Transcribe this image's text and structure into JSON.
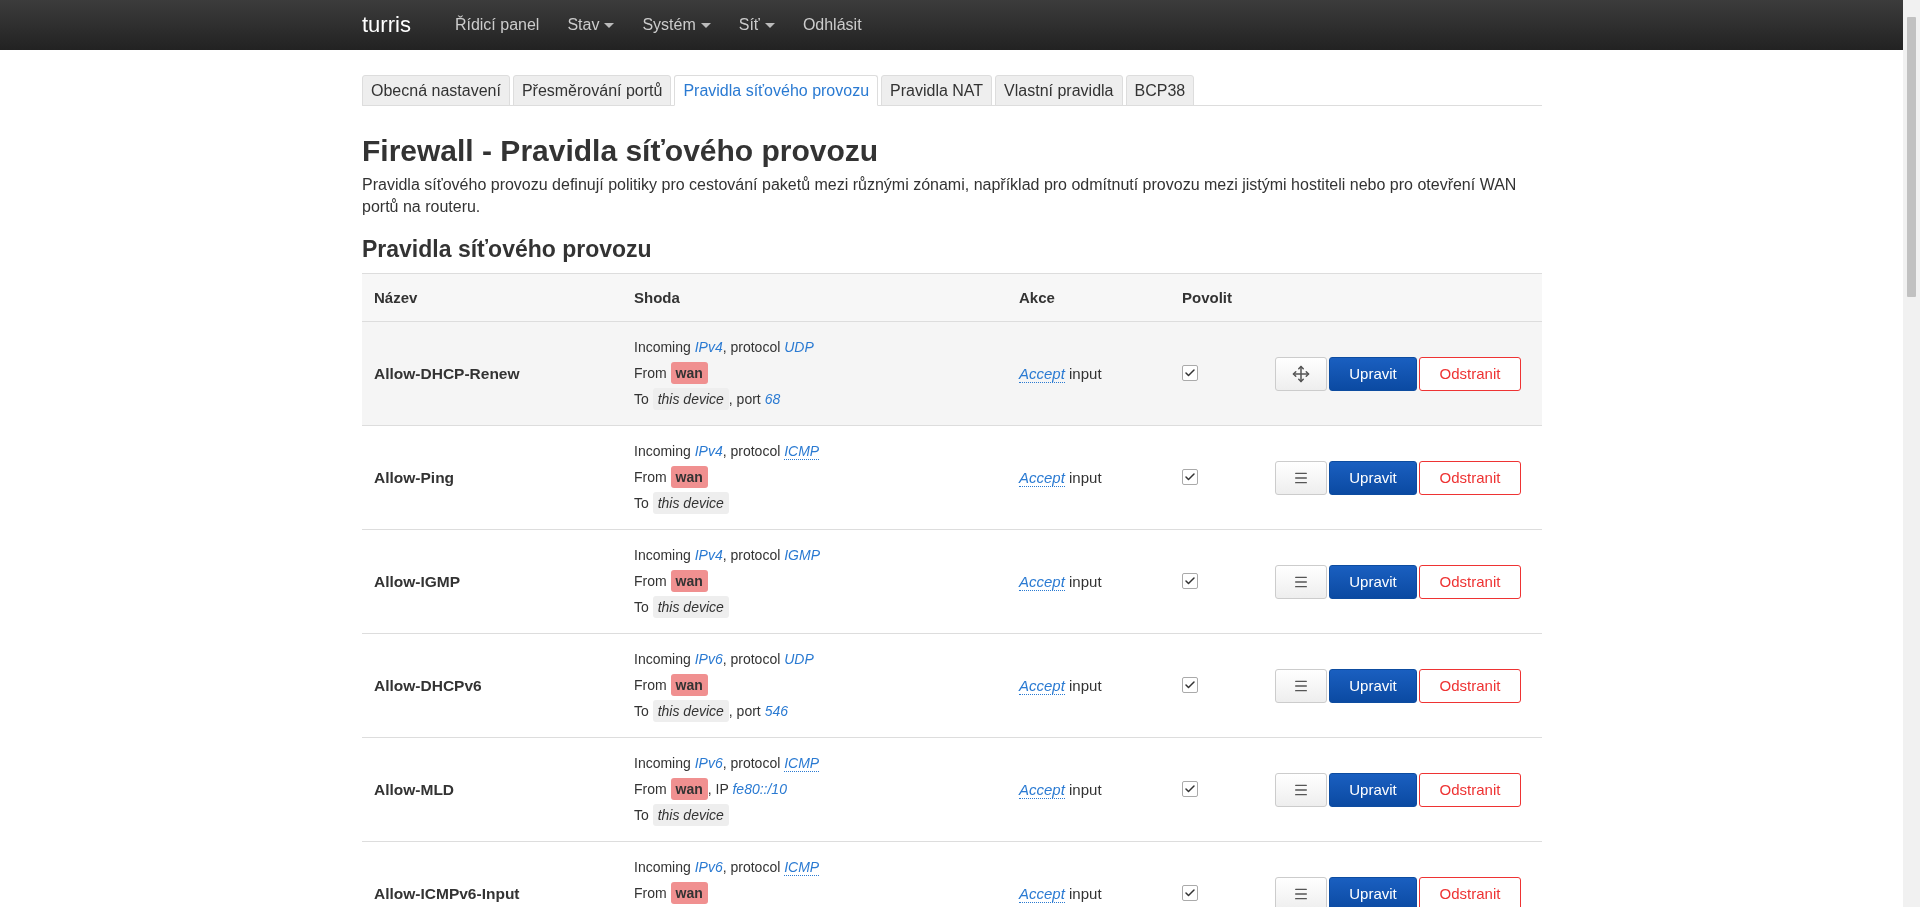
{
  "navbar": {
    "brand": "turris",
    "items": [
      {
        "label": "Řídicí panel",
        "dropdown": false
      },
      {
        "label": "Stav",
        "dropdown": true
      },
      {
        "label": "Systém",
        "dropdown": true
      },
      {
        "label": "Síť",
        "dropdown": true
      },
      {
        "label": "Odhlásit",
        "dropdown": false
      }
    ]
  },
  "tabs": [
    {
      "label": "Obecná nastavení",
      "selected": false
    },
    {
      "label": "Přesměrování portů",
      "selected": false
    },
    {
      "label": "Pravidla síťového provozu",
      "selected": true
    },
    {
      "label": "Pravidla NAT",
      "selected": false
    },
    {
      "label": "Vlastní pravidla",
      "selected": false
    },
    {
      "label": "BCP38",
      "selected": false
    }
  ],
  "title": "Firewall - Pravidla síťového provozu",
  "description": "Pravidla síťového provozu definují politiky pro cestování paketů mezi různými zónami, například pro odmítnutí provozu mezi jistými hostiteli nebo pro otevření WAN portů na routeru.",
  "section_title": "Pravidla síťového provozu",
  "table": {
    "columns": [
      "Název",
      "Shoda",
      "Akce",
      "Povolit"
    ],
    "rows": [
      {
        "name": "Allow-DHCP-Renew",
        "hovered": true,
        "match": [
          [
            {
              "kind": "text",
              "text": "Incoming "
            },
            {
              "kind": "value",
              "text": "IPv4"
            },
            {
              "kind": "text",
              "text": ", protocol "
            },
            {
              "kind": "value",
              "text": "UDP"
            }
          ],
          [
            {
              "kind": "text",
              "text": "From "
            },
            {
              "kind": "zone",
              "text": "wan"
            }
          ],
          [
            {
              "kind": "text",
              "text": "To "
            },
            {
              "kind": "device",
              "text": "this device"
            },
            {
              "kind": "text",
              "text": ", port "
            },
            {
              "kind": "value",
              "text": "68"
            }
          ]
        ],
        "action": "Accept",
        "action_suffix": "input",
        "enabled": true,
        "edit": "Upravit",
        "delete": "Odstranit"
      },
      {
        "name": "Allow-Ping",
        "hovered": false,
        "match": [
          [
            {
              "kind": "text",
              "text": "Incoming "
            },
            {
              "kind": "value",
              "text": "IPv4"
            },
            {
              "kind": "text",
              "text": ", protocol "
            },
            {
              "kind": "abbr",
              "text": "ICMP"
            }
          ],
          [
            {
              "kind": "text",
              "text": "From "
            },
            {
              "kind": "zone",
              "text": "wan"
            }
          ],
          [
            {
              "kind": "text",
              "text": "To "
            },
            {
              "kind": "device",
              "text": "this device"
            }
          ]
        ],
        "action": "Accept",
        "action_suffix": "input",
        "enabled": true,
        "edit": "Upravit",
        "delete": "Odstranit"
      },
      {
        "name": "Allow-IGMP",
        "hovered": false,
        "match": [
          [
            {
              "kind": "text",
              "text": "Incoming "
            },
            {
              "kind": "value",
              "text": "IPv4"
            },
            {
              "kind": "text",
              "text": ", protocol "
            },
            {
              "kind": "value",
              "text": "IGMP"
            }
          ],
          [
            {
              "kind": "text",
              "text": "From "
            },
            {
              "kind": "zone",
              "text": "wan"
            }
          ],
          [
            {
              "kind": "text",
              "text": "To "
            },
            {
              "kind": "device",
              "text": "this device"
            }
          ]
        ],
        "action": "Accept",
        "action_suffix": "input",
        "enabled": true,
        "edit": "Upravit",
        "delete": "Odstranit"
      },
      {
        "name": "Allow-DHCPv6",
        "hovered": false,
        "match": [
          [
            {
              "kind": "text",
              "text": "Incoming "
            },
            {
              "kind": "value",
              "text": "IPv6"
            },
            {
              "kind": "text",
              "text": ", protocol "
            },
            {
              "kind": "value",
              "text": "UDP"
            }
          ],
          [
            {
              "kind": "text",
              "text": "From "
            },
            {
              "kind": "zone",
              "text": "wan"
            }
          ],
          [
            {
              "kind": "text",
              "text": "To "
            },
            {
              "kind": "device",
              "text": "this device"
            },
            {
              "kind": "text",
              "text": ", port "
            },
            {
              "kind": "value",
              "text": "546"
            }
          ]
        ],
        "action": "Accept",
        "action_suffix": "input",
        "enabled": true,
        "edit": "Upravit",
        "delete": "Odstranit"
      },
      {
        "name": "Allow-MLD",
        "hovered": false,
        "match": [
          [
            {
              "kind": "text",
              "text": "Incoming "
            },
            {
              "kind": "value",
              "text": "IPv6"
            },
            {
              "kind": "text",
              "text": ", protocol "
            },
            {
              "kind": "abbr",
              "text": "ICMP"
            }
          ],
          [
            {
              "kind": "text",
              "text": "From "
            },
            {
              "kind": "zone",
              "text": "wan"
            },
            {
              "kind": "text",
              "text": ", IP "
            },
            {
              "kind": "value",
              "text": "fe80::/10"
            }
          ],
          [
            {
              "kind": "text",
              "text": "To "
            },
            {
              "kind": "device",
              "text": "this device"
            }
          ]
        ],
        "action": "Accept",
        "action_suffix": "input",
        "enabled": true,
        "edit": "Upravit",
        "delete": "Odstranit"
      },
      {
        "name": "Allow-ICMPv6-Input",
        "hovered": false,
        "match": [
          [
            {
              "kind": "text",
              "text": "Incoming "
            },
            {
              "kind": "value",
              "text": "IPv6"
            },
            {
              "kind": "text",
              "text": ", protocol "
            },
            {
              "kind": "abbr",
              "text": "ICMP"
            }
          ],
          [
            {
              "kind": "text",
              "text": "From "
            },
            {
              "kind": "zone",
              "text": "wan"
            }
          ]
        ],
        "action": "Accept",
        "action_suffix": "input",
        "enabled": true,
        "edit": "Upravit",
        "delete": "Odstranit"
      }
    ]
  }
}
